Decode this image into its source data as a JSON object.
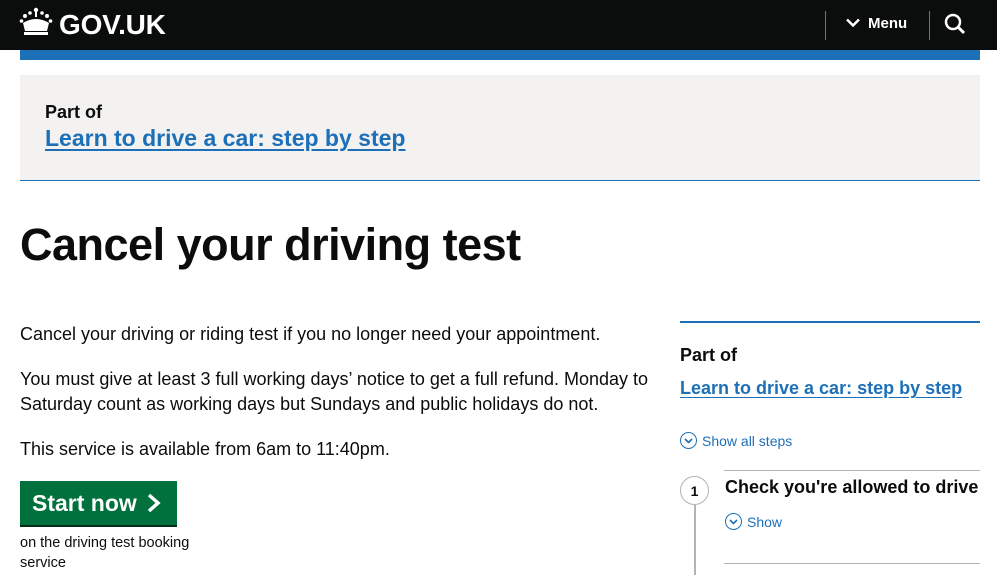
{
  "header": {
    "logo_text": "GOV.UK",
    "menu_label": "Menu",
    "icons": [
      "crown-icon",
      "chevron-down-icon",
      "search-icon"
    ]
  },
  "part_of": {
    "label": "Part of",
    "link": "Learn to drive a car: step by step"
  },
  "main": {
    "title": "Cancel your driving test",
    "paragraphs": [
      "Cancel your driving or riding test if you no longer need your appointment.",
      "You must give at least 3 full working days’ notice to get a full refund. Monday to Saturday count as working days but Sundays and public holidays do not.",
      "This service is available from 6am to 11:40pm."
    ],
    "start_button": "Start now",
    "start_note": "on the driving test booking service"
  },
  "sidebar": {
    "part_of_label": "Part of",
    "link": "Learn to drive a car: step by step",
    "show_all": "Show all steps",
    "steps": [
      {
        "number": "1",
        "title": "Check you're allowed to drive",
        "show": "Show"
      }
    ]
  },
  "colors": {
    "header_bg": "#0b0c0c",
    "link_blue": "#1d70b8",
    "button_green": "#00703c",
    "panel_grey": "#f3f2f1"
  }
}
